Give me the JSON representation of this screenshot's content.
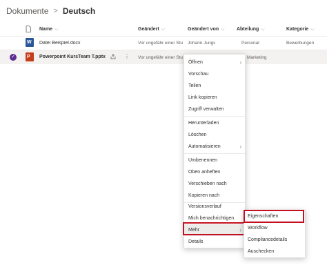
{
  "breadcrumb": {
    "root": "Dokumente",
    "separator": ">",
    "current": "Deutsch"
  },
  "columns": {
    "name": "Name",
    "modified": "Geändert",
    "modified_by": "Geändert von",
    "department": "Abteilung",
    "category": "Kategorie"
  },
  "rows": [
    {
      "name": "Datei Beispiel.docx",
      "modified": "Vor ungefähr einer Stu...",
      "modified_by": "Johann Jungs",
      "department": "Personal",
      "category": "Bewerbungen",
      "icon": "word-file-icon"
    },
    {
      "name": "Powerpoint KursTeam T.pptx",
      "modified": "Vor ungefähr einer Stu...",
      "department": "Marketing",
      "icon": "powerpoint-file-icon",
      "selected": true
    }
  ],
  "context_menu": {
    "items": [
      {
        "label": "Öffnen",
        "submenu": true
      },
      {
        "label": "Vorschau"
      },
      {
        "label": "Teilen"
      },
      {
        "label": "Link kopieren"
      },
      {
        "label": "Zugriff verwalten"
      },
      {
        "label": "Herunterladen"
      },
      {
        "label": "Löschen"
      },
      {
        "label": "Automatisieren",
        "submenu": true
      },
      {
        "label": "Umbenennen"
      },
      {
        "label": "Oben anheften"
      },
      {
        "label": "Verschieben nach"
      },
      {
        "label": "Kopieren nach"
      },
      {
        "label": "Versionsverlauf"
      },
      {
        "label": "Mich benachrichtigen"
      },
      {
        "label": "Mehr",
        "submenu": true,
        "highlighted": true
      },
      {
        "label": "Details"
      }
    ]
  },
  "submenu": {
    "items": [
      {
        "label": "Eigenschaften",
        "highlighted": true
      },
      {
        "label": "Workflow"
      },
      {
        "label": "Compliancedetails"
      },
      {
        "label": "Auschecken"
      }
    ]
  },
  "colors": {
    "highlight_box": "#c50f1f",
    "accent": "#5c2d91",
    "word": "#2b579a",
    "powerpoint": "#c43e1c"
  }
}
